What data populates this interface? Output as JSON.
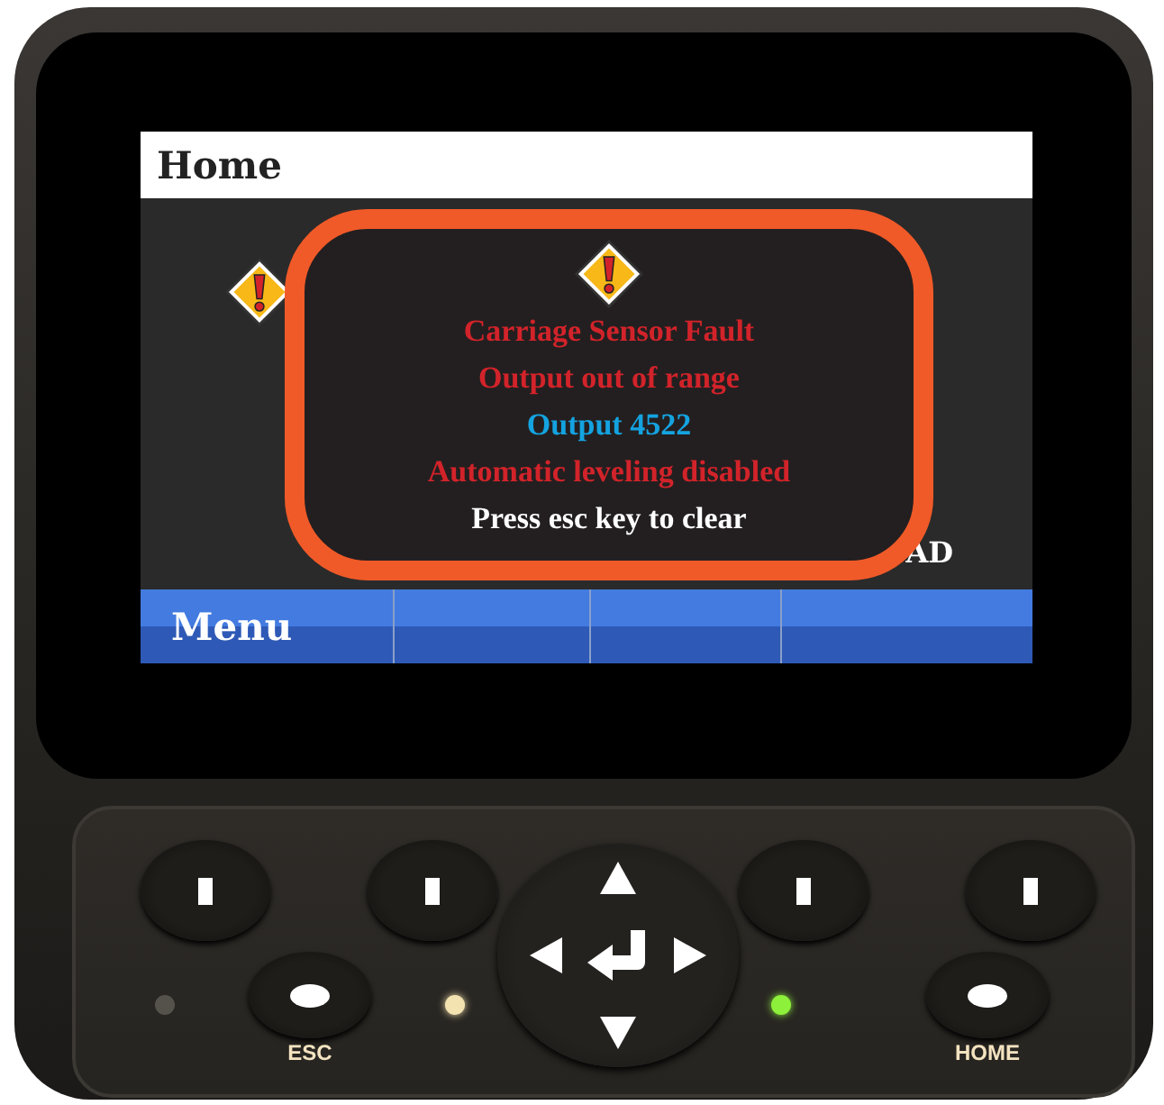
{
  "screen": {
    "title": "Home",
    "background_text": "AD",
    "menu_label": "Menu",
    "dialog": {
      "lines": [
        {
          "text": "Carriage Sensor Fault",
          "color": "#d2232a"
        },
        {
          "text": "Output out of range",
          "color": "#d2232a"
        },
        {
          "text": "Output 4522",
          "color": "#14a3e0"
        },
        {
          "text": "Automatic leveling disabled",
          "color": "#d2232a"
        },
        {
          "text": "Press esc key to clear",
          "color": "#ffffff"
        }
      ]
    }
  },
  "keypad": {
    "buttons": [
      {
        "label": "ESC"
      },
      {
        "label": "HOME"
      }
    ],
    "leds": [
      {
        "on": false
      },
      {
        "on": true,
        "color": "#f3e3b0"
      },
      {
        "on": true,
        "color": "#8df03a"
      }
    ]
  }
}
